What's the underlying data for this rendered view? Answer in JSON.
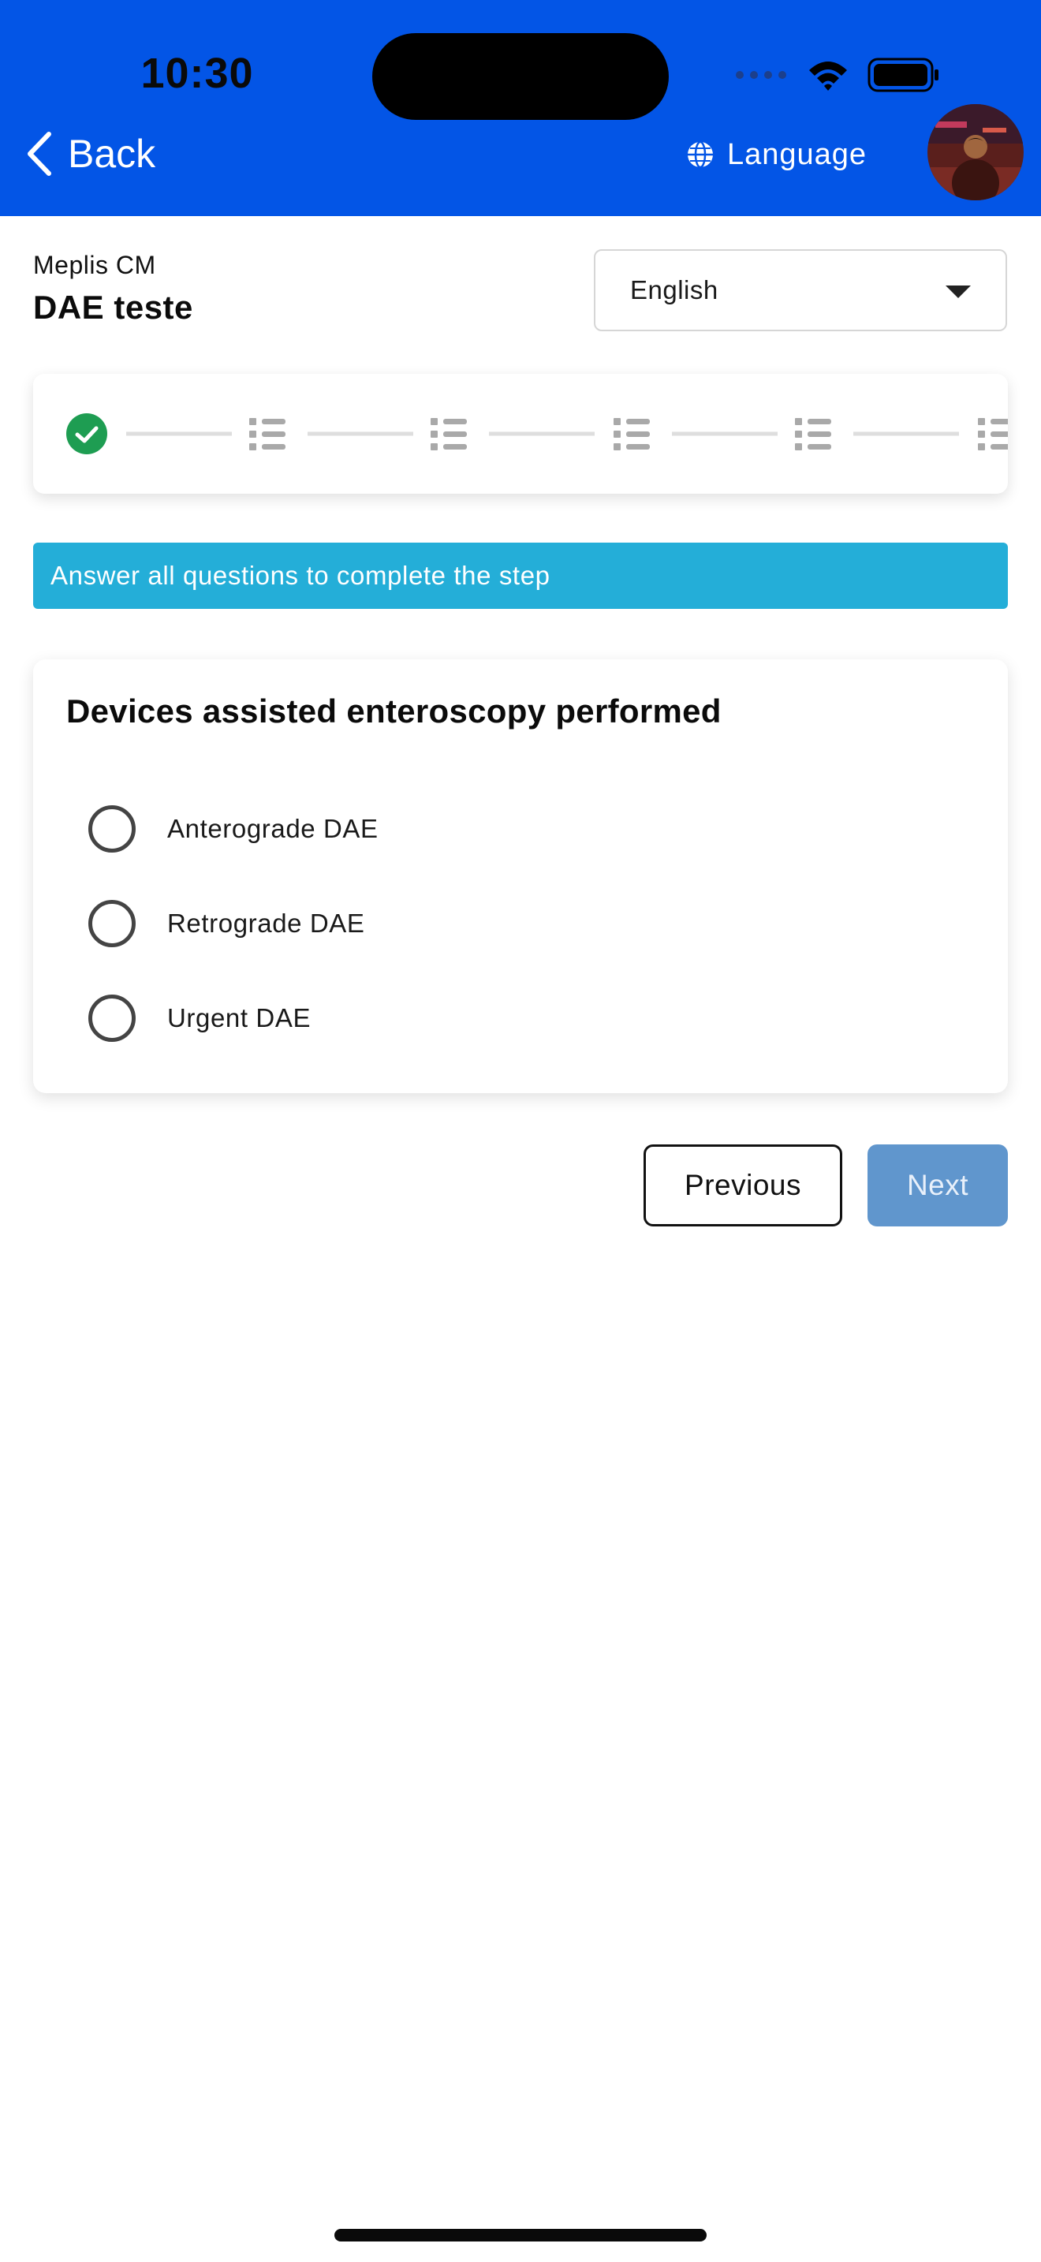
{
  "status_bar": {
    "time": "10:30"
  },
  "header": {
    "back_label": "Back",
    "language_label": "Language",
    "background_color": "#0355e6"
  },
  "page": {
    "subtitle": "Meplis CM",
    "title": "DAE teste",
    "language_select": {
      "selected": "English"
    }
  },
  "stepper": {
    "steps": [
      {
        "state": "completed",
        "icon": "check-circle-icon"
      },
      {
        "state": "pending",
        "icon": "list-icon"
      },
      {
        "state": "pending",
        "icon": "list-icon"
      },
      {
        "state": "pending",
        "icon": "list-icon"
      },
      {
        "state": "pending",
        "icon": "list-icon"
      },
      {
        "state": "pending",
        "icon": "list-icon"
      }
    ],
    "completed_color": "#1e9d52"
  },
  "banner": {
    "text": "Answer all questions to complete the step",
    "color": "#24aed8"
  },
  "question": {
    "title": "Devices assisted enteroscopy performed",
    "options": [
      {
        "label": "Anterograde DAE",
        "selected": false
      },
      {
        "label": "Retrograde DAE",
        "selected": false
      },
      {
        "label": "Urgent DAE",
        "selected": false
      }
    ]
  },
  "navigation": {
    "previous_label": "Previous",
    "next_label": "Next",
    "next_disabled": true,
    "next_color": "#6096cd"
  }
}
